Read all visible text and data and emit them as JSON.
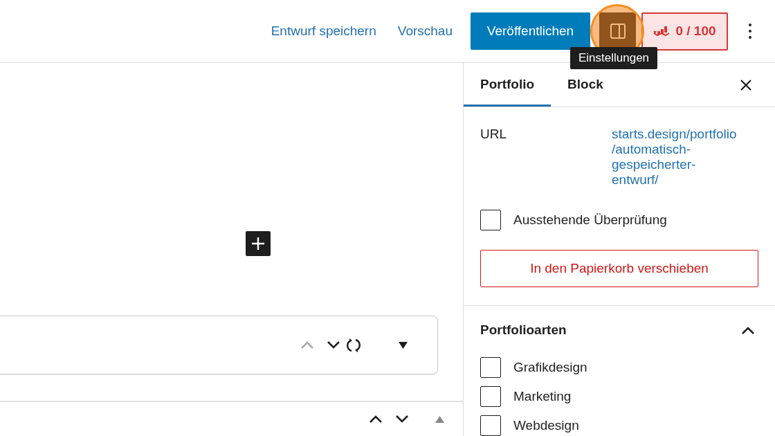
{
  "header": {
    "save_draft": "Entwurf speichern",
    "preview": "Vorschau",
    "publish": "Veröffentlichen",
    "settings": {
      "selected": true,
      "highlighted": true,
      "tooltip": "Einstellungen"
    },
    "score": "0 / 100"
  },
  "editor": {
    "block_controls": [
      {
        "kind": "up",
        "disabled": true
      },
      {
        "kind": "down",
        "disabled": false
      },
      {
        "kind": "rotate",
        "disabled": false
      },
      {
        "kind": "caret-down",
        "disabled": false
      }
    ],
    "row_controls": [
      {
        "kind": "up",
        "disabled": false
      },
      {
        "kind": "down",
        "disabled": false
      },
      {
        "kind": "caret-up",
        "disabled": true
      }
    ]
  },
  "sidebar": {
    "tabs": [
      {
        "label": "Portfolio",
        "selected": true
      },
      {
        "label": "Block",
        "selected": false
      }
    ],
    "url_label": "URL",
    "url_lines": [
      "starts.design/portfolio",
      "/automatisch-",
      "gespeicherter-",
      "entwurf/"
    ],
    "pending_review": {
      "label": "Ausstehende Überprüfung",
      "checked": false
    },
    "trash": "In den Papierkorb verschieben",
    "taxonomy": {
      "title": "Portfolioarten",
      "expanded": true,
      "items": [
        {
          "label": "Grafikdesign",
          "checked": false
        },
        {
          "label": "Marketing",
          "checked": false
        },
        {
          "label": "Webdesign",
          "checked": false
        }
      ]
    }
  }
}
